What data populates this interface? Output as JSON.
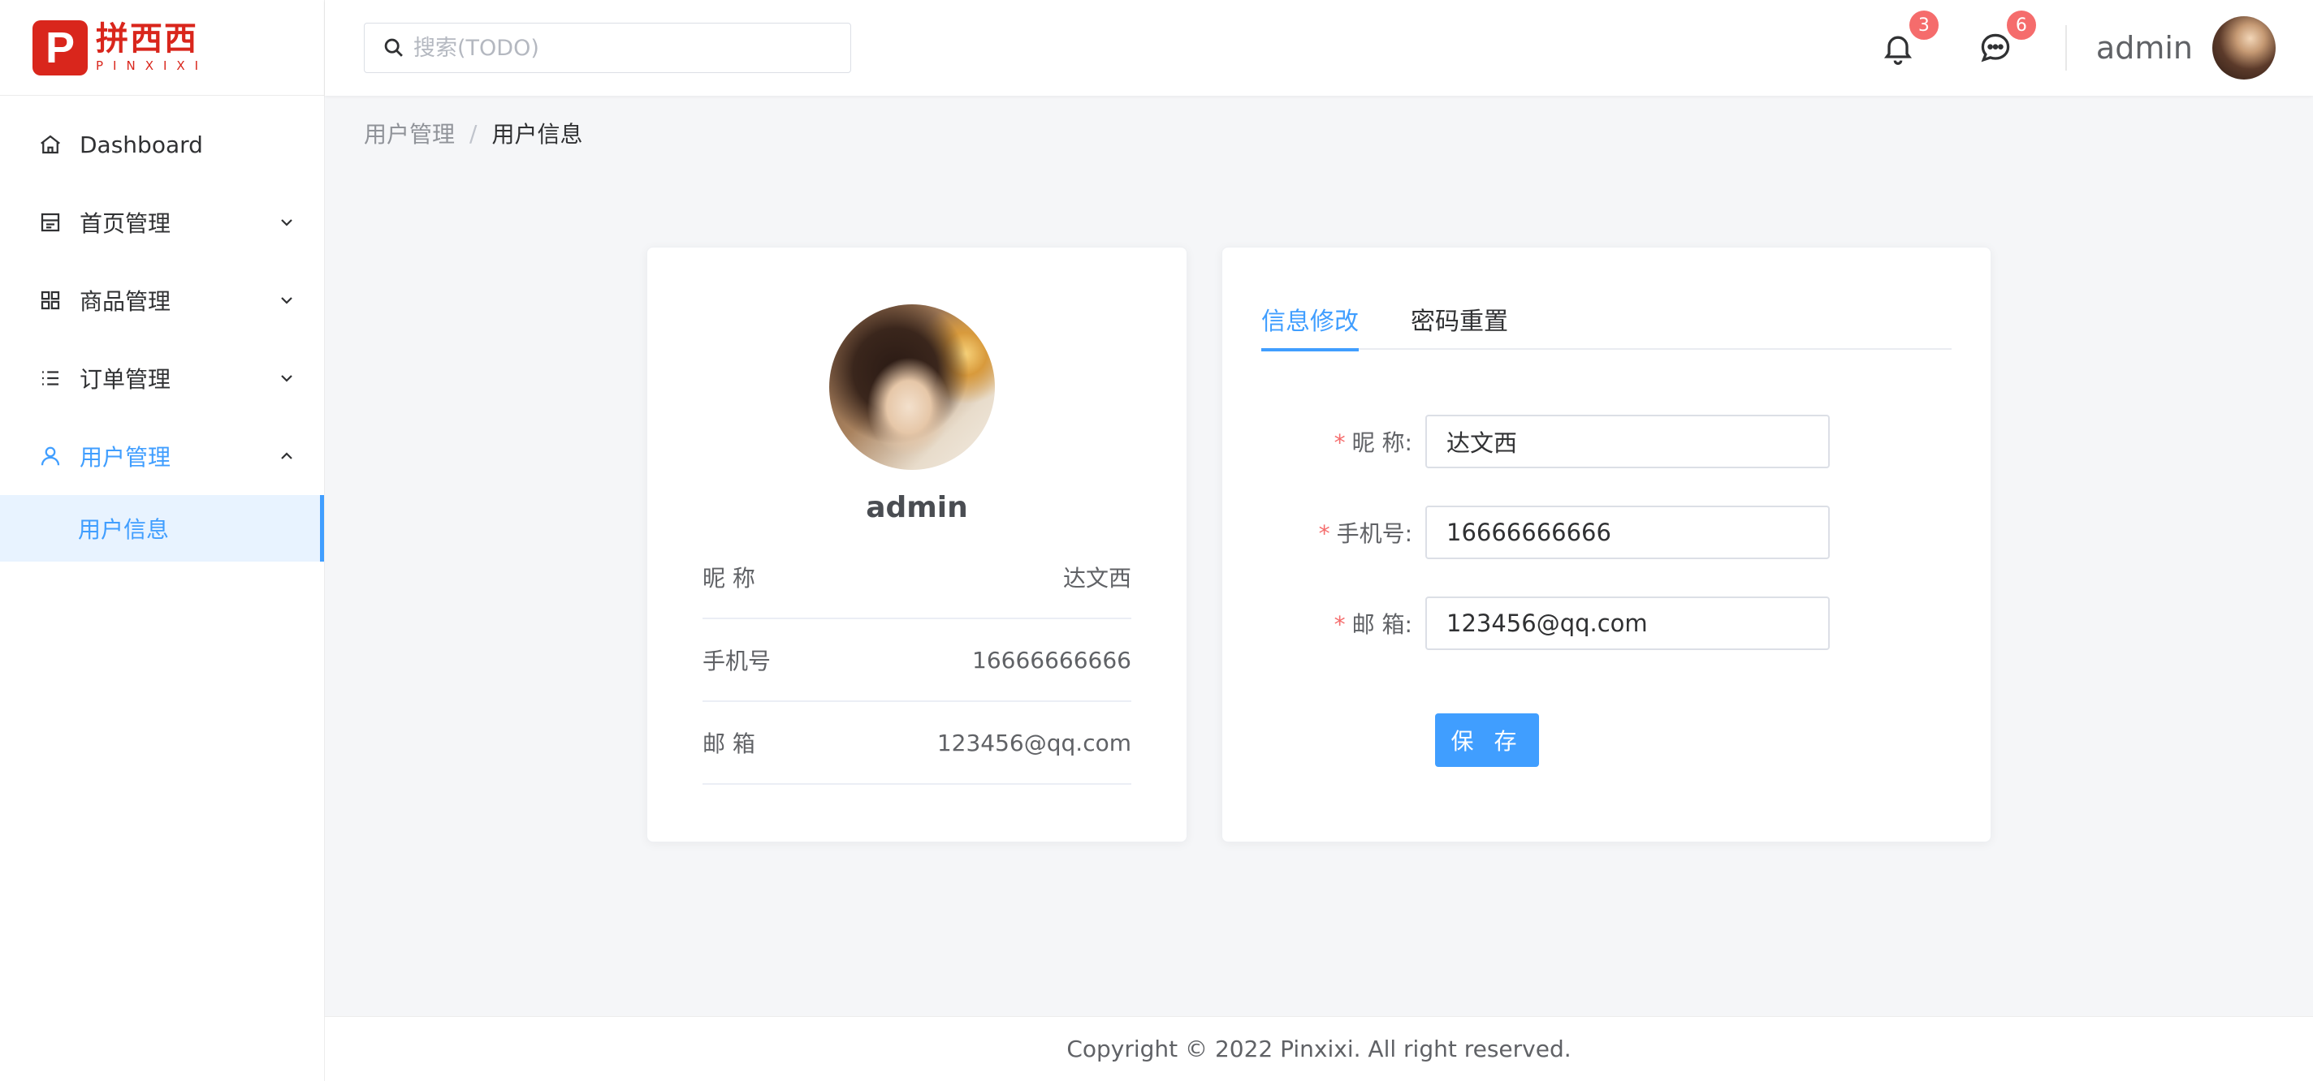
{
  "brand": {
    "logo_letter": "P",
    "name_cn": "拼西西",
    "name_en": "PINXIXI",
    "color": "#d9261c"
  },
  "sidebar": {
    "items": [
      {
        "label": "Dashboard",
        "icon": "home-icon"
      },
      {
        "label": "首页管理",
        "icon": "layout-icon"
      },
      {
        "label": "商品管理",
        "icon": "grid-icon"
      },
      {
        "label": "订单管理",
        "icon": "list-icon"
      },
      {
        "label": "用户管理",
        "icon": "user-icon"
      }
    ],
    "active_sub_item": "用户信息"
  },
  "header": {
    "search_placeholder": "搜索(TODO)",
    "notifications_count": "3",
    "messages_count": "6",
    "username": "admin"
  },
  "breadcrumb": {
    "parent": "用户管理",
    "separator": "/",
    "current": "用户信息"
  },
  "profile": {
    "name": "admin",
    "rows": [
      {
        "label": "昵 称",
        "value": "达文西"
      },
      {
        "label": "手机号",
        "value": "16666666666"
      },
      {
        "label": "邮 箱",
        "value": "123456@qq.com"
      }
    ]
  },
  "edit": {
    "tabs": [
      "信息修改",
      "密码重置"
    ],
    "active_tab": 0,
    "fields": [
      {
        "label": "昵 称:",
        "value": "达文西"
      },
      {
        "label": "手机号:",
        "value": "16666666666"
      },
      {
        "label": "邮 箱:",
        "value": "123456@qq.com"
      }
    ],
    "required_mark": "*",
    "save_label": "保 存"
  },
  "footer": {
    "text": "Copyright © 2022 Pinxixi. All right reserved."
  },
  "colors": {
    "accent": "#409eff",
    "badge": "#f56c6c",
    "background": "#f5f6f8"
  }
}
